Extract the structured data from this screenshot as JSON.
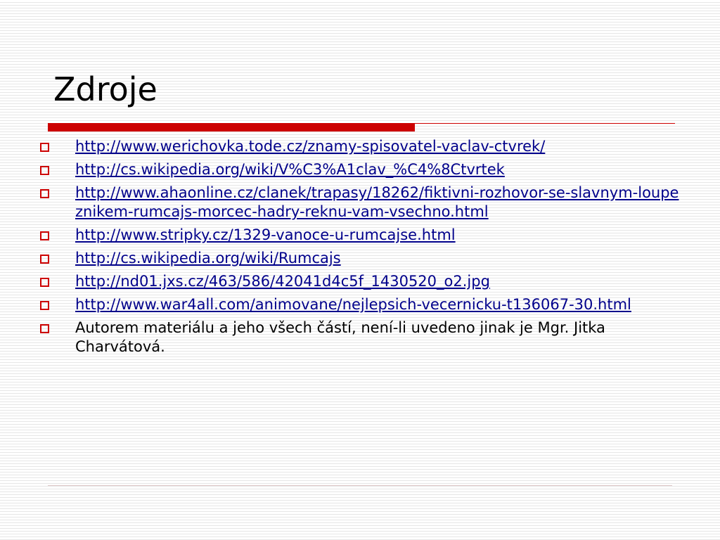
{
  "slide": {
    "title": "Zdroje",
    "items": [
      {
        "text": "http://www.werichovka.tode.cz/znamy-spisovatel-vaclav-ctvrek/",
        "type": "link"
      },
      {
        "text": "http://cs.wikipedia.org/wiki/V%C3%A1clav_%C4%8Ctvrtek",
        "type": "link"
      },
      {
        "text": "http://www.ahaonline.cz/clanek/trapasy/18262/fiktivni-rozhovor-se-slavnym-loupeznikem-rumcajs-morcec-hadry-reknu-vam-vsechno.html",
        "type": "link"
      },
      {
        "text": "http://www.stripky.cz/1329-vanoce-u-rumcajse.html",
        "type": "link"
      },
      {
        "text": "http://cs.wikipedia.org/wiki/Rumcajs",
        "type": "link"
      },
      {
        "text": "http://nd01.jxs.cz/463/586/42041d4c5f_1430520_o2.jpg",
        "type": "link"
      },
      {
        "text": "http://www.war4all.com/animovane/nejlepsich-vecernicku-t136067-30.html",
        "type": "link"
      },
      {
        "text": "Autorem materiálu a jeho všech částí, není-li uvedeno jinak je Mgr. Jitka Charvátová.",
        "type": "text"
      }
    ]
  },
  "bullet_icon": "hollow-square-icon",
  "colors": {
    "accent": "#cc0000",
    "link": "#00008b",
    "text": "#000000",
    "background_stripe": "#e6e6e6"
  }
}
